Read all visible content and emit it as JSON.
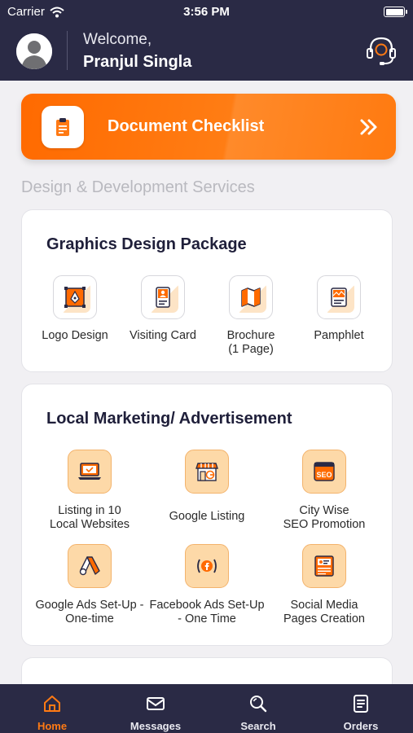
{
  "status_bar": {
    "carrier": "Carrier",
    "time": "3:56 PM"
  },
  "header": {
    "welcome": "Welcome,",
    "user_name": "Pranjul Singla",
    "support_icon": "headset-icon"
  },
  "checklist": {
    "label": "Document Checklist",
    "icon": "clipboard-icon",
    "arrow_icon": "double-chevron-right-icon"
  },
  "section_title": "Design & Development Services",
  "graphics_card": {
    "title": "Graphics Design Package",
    "items": [
      {
        "label": "Logo Design",
        "icon": "pen-tool-icon"
      },
      {
        "label": "Visiting Card",
        "icon": "id-card-icon"
      },
      {
        "label": "Brochure\n(1 Page)",
        "icon": "brochure-map-icon"
      },
      {
        "label": "Pamphlet",
        "icon": "pamphlet-icon"
      }
    ]
  },
  "marketing_card": {
    "title": "Local Marketing/ Advertisement",
    "items": [
      {
        "label": "Listing in 10\nLocal Websites",
        "icon": "laptop-icon"
      },
      {
        "label": "Google Listing",
        "icon": "storefront-icon"
      },
      {
        "label": "City Wise\nSEO Promotion",
        "icon": "seo-icon"
      },
      {
        "label": "Google Ads Set-Up -\nOne-time",
        "icon": "google-ads-icon"
      },
      {
        "label": "Facebook Ads Set-Up\n- One Time",
        "icon": "facebook-icon"
      },
      {
        "label": "Social Media\nPages Creation",
        "icon": "social-page-icon"
      }
    ]
  },
  "bottom_nav": [
    {
      "label": "Home",
      "icon": "home-icon",
      "active": true
    },
    {
      "label": "Messages",
      "icon": "envelope-icon",
      "active": false
    },
    {
      "label": "Search",
      "icon": "search-icon",
      "active": false
    },
    {
      "label": "Orders",
      "icon": "orders-icon",
      "active": false
    }
  ],
  "colors": {
    "brand_dark": "#2a2a45",
    "accent_orange": "#ff7a14",
    "icon_tile": "#fdd9a8"
  }
}
